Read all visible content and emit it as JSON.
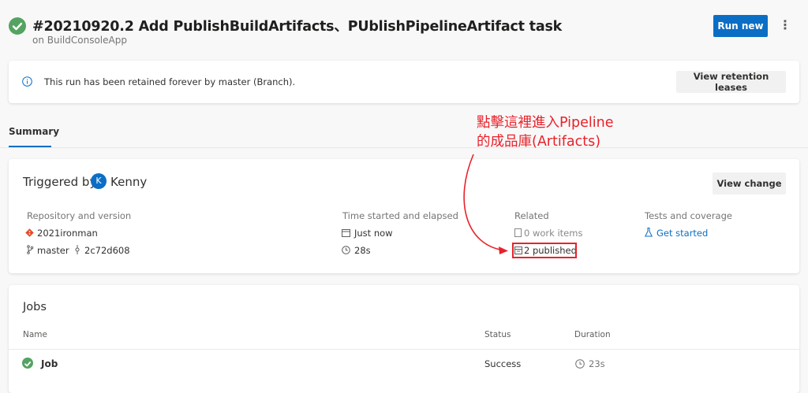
{
  "header": {
    "title": "#20210920.2 Add PublishBuildArtifacts、PUblishPipelineArtifact task",
    "subtitle": "on BuildConsoleApp",
    "run_new": "Run new",
    "more": "⋮"
  },
  "retention": {
    "message": "This run has been retained forever by master (Branch).",
    "button": "View retention leases"
  },
  "tabs": [
    {
      "label": "Summary"
    }
  ],
  "annotation": {
    "line1": "點擊這裡進入Pipeline",
    "line2": "的成品庫(Artifacts)"
  },
  "summary": {
    "triggered_by": "Triggered by",
    "avatar_initial": "K",
    "user": "Kenny",
    "view_change": "View change",
    "repo": {
      "label": "Repository and version",
      "name": "2021ironman",
      "branch": "master",
      "commit": "2c72d608"
    },
    "time": {
      "label": "Time started and elapsed",
      "started": "Just now",
      "elapsed": "28s"
    },
    "related": {
      "label": "Related",
      "work_items": "0 work items",
      "published": "2 published"
    },
    "tests": {
      "label": "Tests and coverage",
      "link": "Get started"
    }
  },
  "jobs": {
    "title": "Jobs",
    "headers": {
      "name": "Name",
      "status": "Status",
      "duration": "Duration"
    },
    "rows": [
      {
        "name": "Job",
        "status": "Success",
        "duration": "23s"
      }
    ]
  },
  "colors": {
    "accent": "#0b6ec5",
    "success": "#55a362",
    "annotation": "#e8222a"
  }
}
